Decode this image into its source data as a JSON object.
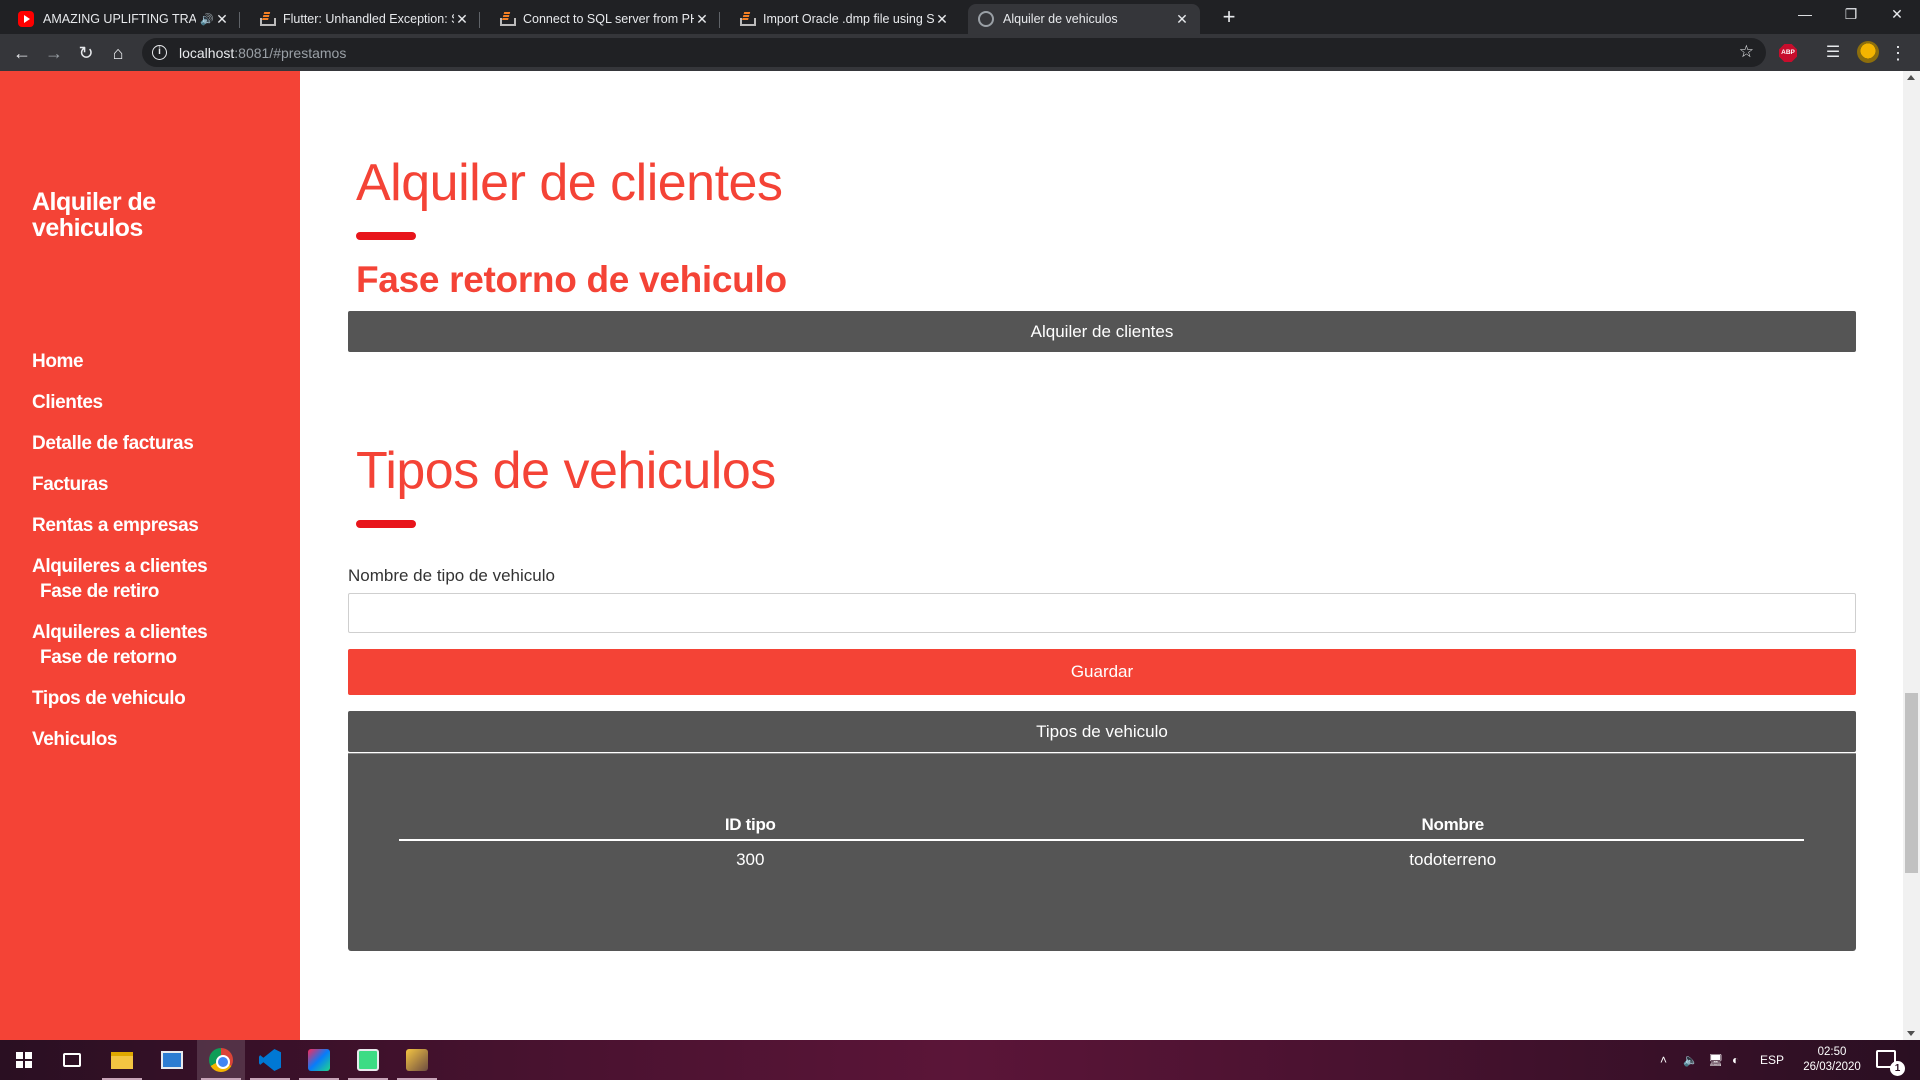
{
  "browser": {
    "tabs": [
      {
        "title": "AMAZING UPLIFTING TRANCE",
        "favicon": "youtube-icon",
        "audio": true,
        "active": false
      },
      {
        "title": "Flutter: Unhandled Exception: Se",
        "favicon": "stackoverflow-icon",
        "active": false
      },
      {
        "title": "Connect to SQL server from PHP",
        "favicon": "stackoverflow-icon",
        "active": false
      },
      {
        "title": "Import Oracle .dmp file using SQ",
        "favicon": "stackoverflow-icon",
        "active": false
      },
      {
        "title": "Alquiler de vehiculos",
        "favicon": "globe-icon",
        "active": true
      }
    ],
    "url_host": "localhost",
    "url_rest": ":8081/#prestamos",
    "extension_label": "ABP"
  },
  "sidebar": {
    "brand": "Alquiler de vehiculos",
    "items": [
      {
        "label": "Home"
      },
      {
        "label": "Clientes"
      },
      {
        "label": "Detalle de facturas"
      },
      {
        "label": "Facturas"
      },
      {
        "label": "Rentas a empresas"
      },
      {
        "label": "Alquileres a clientes",
        "sub": "Fase de retiro"
      },
      {
        "label": "Alquileres a clientes",
        "sub": "Fase de retorno"
      },
      {
        "label": "Tipos de vehiculo"
      },
      {
        "label": "Vehiculos"
      }
    ]
  },
  "section1": {
    "title": "Alquiler de clientes",
    "subtitle": "Fase retorno de vehiculo",
    "panel_label": "Alquiler de clientes"
  },
  "section2": {
    "title": "Tipos de vehiculos",
    "field_label": "Nombre de tipo de vehiculo",
    "field_value": "",
    "save_label": "Guardar",
    "panel_label": "Tipos de vehiculo",
    "table": {
      "columns": [
        "ID tipo",
        "Nombre"
      ],
      "rows": [
        [
          "300",
          "todoterreno"
        ]
      ]
    }
  },
  "taskbar": {
    "language": "ESP",
    "time": "02:50",
    "date": "26/03/2020",
    "notification_count": "1"
  },
  "colors": {
    "accent": "#f44336",
    "panel": "#555555",
    "underline": "#e8151b"
  }
}
